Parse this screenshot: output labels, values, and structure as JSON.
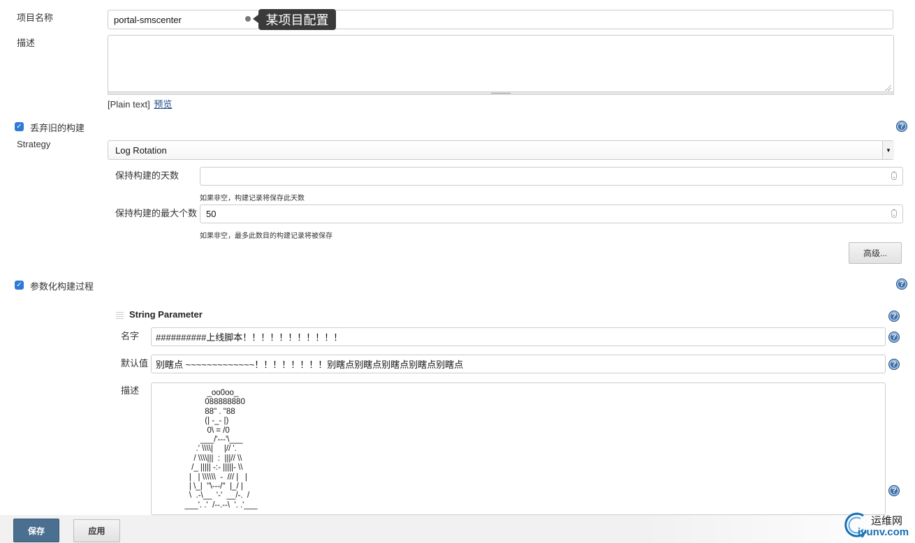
{
  "project": {
    "name_label": "项目名称",
    "name_value": "portal-smscenter",
    "tooltip": "某项目配置",
    "desc_label": "描述",
    "desc_value": "",
    "plain_text": "[Plain text]",
    "preview_link": "预览"
  },
  "discard": {
    "checkbox_label": "丢弃旧的构建",
    "strategy_label": "Strategy",
    "strategy_value": "Log Rotation",
    "days_label": "保持构建的天数",
    "days_value": "",
    "days_hint": "如果非空，构建记录将保存此天数",
    "max_label": "保持构建的最大个数",
    "max_value": "50",
    "max_hint": "如果非空，最多此数目的构建记录将被保存",
    "advanced_button": "高级..."
  },
  "params": {
    "checkbox_label": "参数化构建过程",
    "section_title": "String Parameter",
    "name_label": "名字",
    "name_value": "##########上线脚本！！！！！！！！！！！",
    "default_label": "默认值",
    "default_value": "别瞎点 ~~~~~~~~~~~~~！！！！！！！！别瞎点别瞎点别瞎点别瞎点别瞎点",
    "desc_label": "描述",
    "desc_ascii": "                       _oo0oo_\n                      088888880\n                      88\" . \"88\n                      (| -_- |)\n                       0\\ = /0\n                    ___/'---'\\___\n                  .' \\\\\\\\|     |// '.\n                 / \\\\\\\\|||  :  |||// \\\\\n                /_ ||||| -:- |||||- \\\\\n               |   | \\\\\\\\\\\\  -  /// |   |\n               | \\_|  ''\\---/''  |_/ |\n               \\  .-\\__  '-'  __/-.  /\n             ___'. .'  /--.--\\  '. .'___"
  },
  "footer": {
    "save_button": "保存",
    "apply_button": "应用"
  },
  "watermark": {
    "top": "运维网",
    "bottom": "iyunv.com"
  },
  "colors": {
    "checkbox": "#2f7ad6",
    "save_button_bg": "#4b6f90",
    "link": "#204a87",
    "help_icon": "#3d6fa8"
  }
}
